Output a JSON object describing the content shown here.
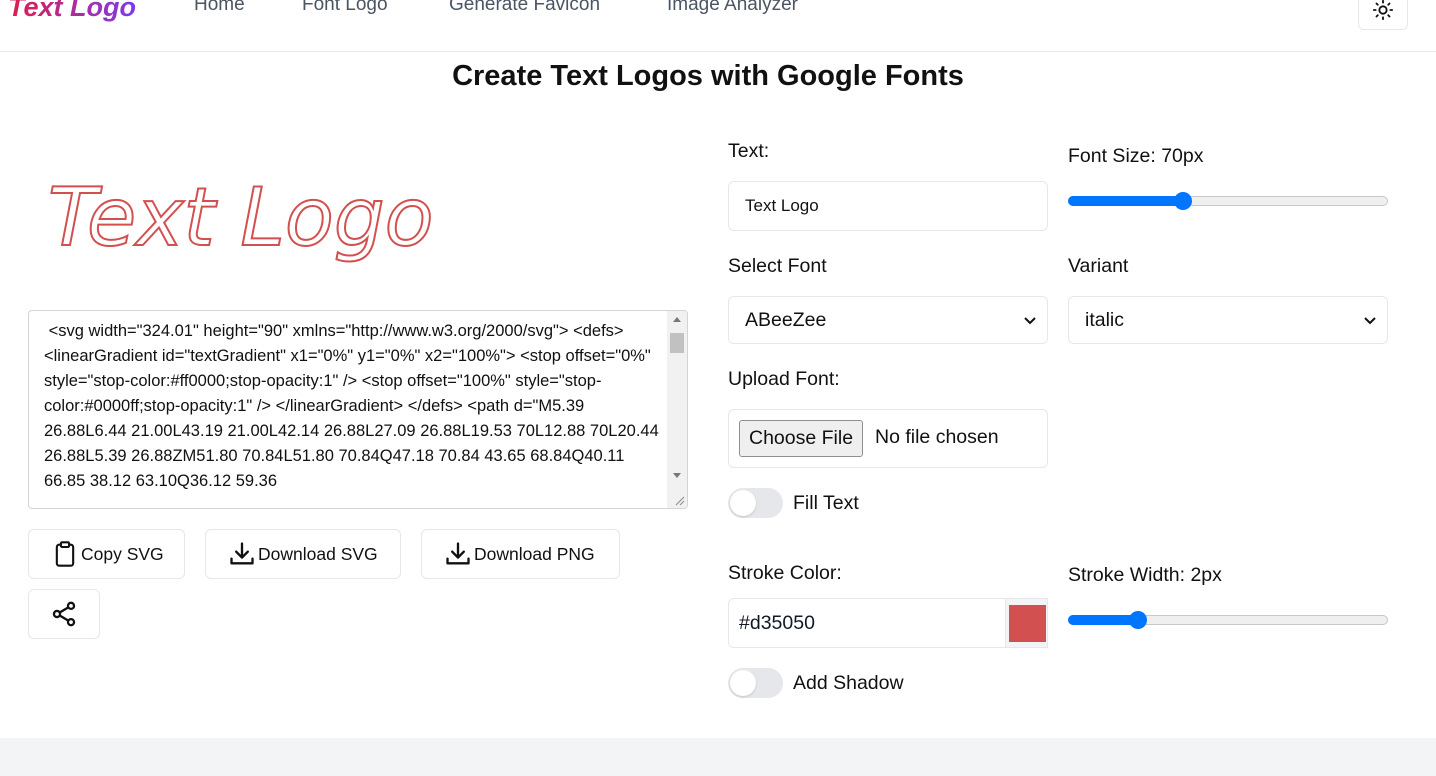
{
  "nav": {
    "brand": "Text Logo",
    "links": [
      "Home",
      "Font Logo",
      "Generate Favicon",
      "Image Analyzer"
    ]
  },
  "page": {
    "title": "Create Text Logos with Google Fonts"
  },
  "preview": {
    "text": "Text Logo",
    "stroke_color": "#d35050"
  },
  "svg_code": " <svg width=\"324.01\" height=\"90\" xmlns=\"http://www.w3.org/2000/svg\"> <defs> <linearGradient id=\"textGradient\" x1=\"0%\" y1=\"0%\" x2=\"100%\"> <stop offset=\"0%\" style=\"stop-color:#ff0000;stop-opacity:1\" /> <stop offset=\"100%\" style=\"stop-color:#0000ff;stop-opacity:1\" /> </linearGradient> </defs> <path d=\"M5.39 26.88L6.44 21.00L43.19 21.00L42.14 26.88L27.09 26.88L19.53 70L12.88 70L20.44 26.88L5.39 26.88ZM51.80 70.84L51.80 70.84Q47.18 70.84 43.65 68.84Q40.11 66.85 38.12 63.10Q36.12 59.36",
  "actions": {
    "copy_svg": "Copy SVG",
    "download_svg": "Download SVG",
    "download_png": "Download PNG"
  },
  "form": {
    "text_label": "Text:",
    "text_value": "Text Logo",
    "font_size_label": "Font Size: 70px",
    "font_size_fraction": 0.36,
    "select_font_label": "Select Font",
    "select_font_value": "ABeeZee",
    "variant_label": "Variant",
    "variant_value": "italic",
    "upload_font_label": "Upload Font:",
    "choose_file": "Choose File",
    "file_status": "No file chosen",
    "fill_text_label": "Fill Text",
    "fill_text_on": false,
    "stroke_color_label": "Stroke Color:",
    "stroke_color_value": "#d35050",
    "stroke_width_label": "Stroke Width: 2px",
    "stroke_width_fraction": 0.22,
    "add_shadow_label": "Add Shadow",
    "add_shadow_on": false
  },
  "colors": {
    "accent": "#0075ff",
    "stroke": "#d35050",
    "brand_start": "#e11d48",
    "brand_end": "#7c3aed"
  }
}
